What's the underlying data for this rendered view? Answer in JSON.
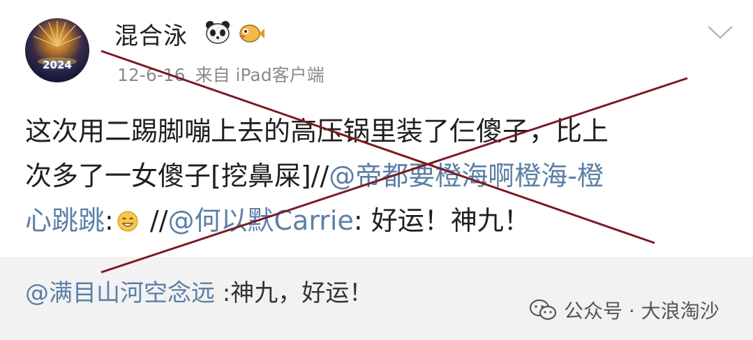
{
  "post": {
    "username": "混合泳",
    "date": "12-6-16",
    "source": "来自 iPad客户端",
    "avatar_badge": "2024",
    "body": {
      "line1": "这次用二踢脚嘣上去的高压锅里装了仨傻子，比上",
      "line2_text": "次多了一女傻子[挖鼻屎]//",
      "line2_mention": "@帝都要橙海啊橙海-橙",
      "line3_mention_cont": "心跳跳",
      "line3_colon": ":",
      "line3_sep": " //",
      "line3_mention2": "@何以默Carrie",
      "line3_text": ": 好运！神九！"
    }
  },
  "repost": {
    "mention": "@满目山河空念远",
    "text": " :神九，好运！"
  },
  "watermark": {
    "text": "公众号 · 大浪淘沙"
  },
  "icons": {
    "emoji_1": "panda-emoji-icon",
    "emoji_2": "pufferfish-emoji-icon",
    "menu": "chevron-down-icon",
    "inline": "grin-emoji-icon",
    "watermark": "wechat-icon"
  },
  "colors": {
    "mention": "#5b7fa6",
    "cross": "#7a1a22",
    "repost_bg": "#f2f2f2"
  }
}
